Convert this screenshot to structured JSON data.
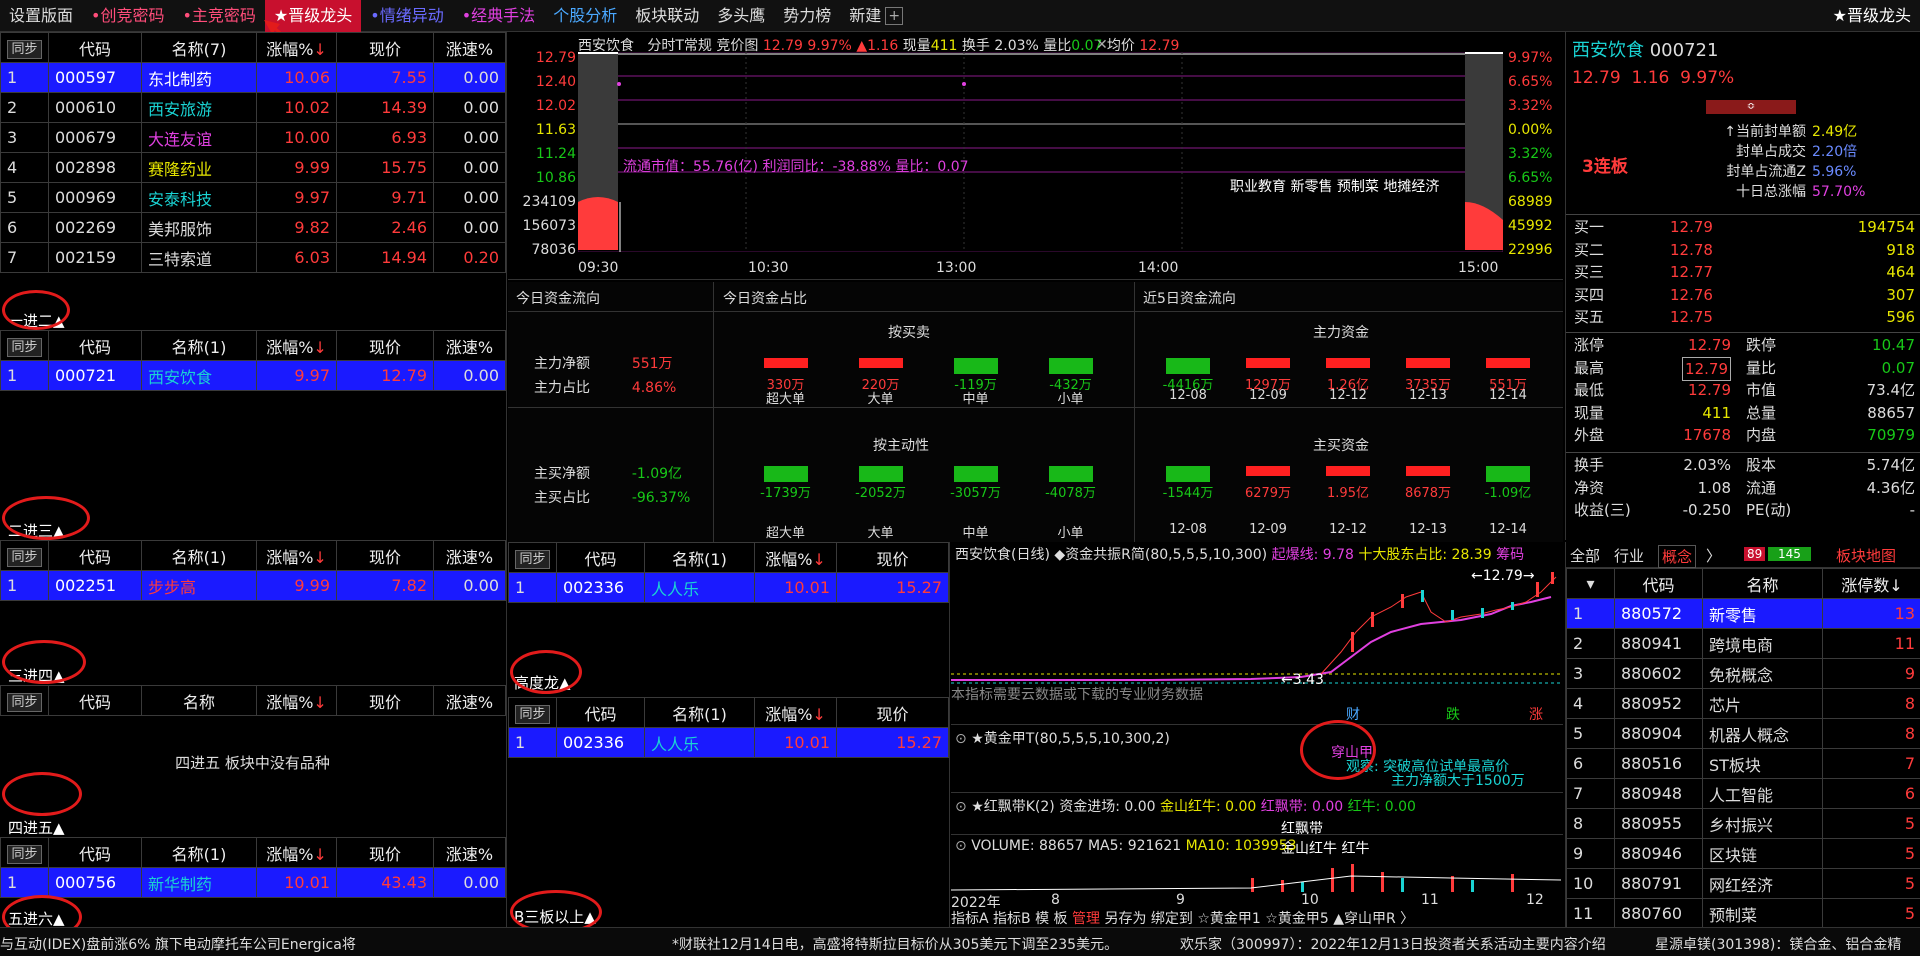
{
  "menu": {
    "items": [
      "设置版面",
      "•创竞密码",
      "•主竞密码",
      "★晋级龙头",
      "•情绪异动",
      "•经典手法",
      "个股分析",
      "板块联动",
      "多头鹰",
      "势力榜",
      "新建"
    ],
    "right": "★晋级龙头"
  },
  "left_tables": {
    "header": {
      "sync": "同步",
      "code": "代码",
      "change": "涨幅%",
      "price": "现价",
      "speed": "涨速%"
    },
    "t1": {
      "name_h": "名称(7)",
      "rows": [
        {
          "i": "1",
          "code": "000597",
          "name": "东北制药",
          "chg": "10.06",
          "price": "7.55",
          "spd": "0.00"
        },
        {
          "i": "2",
          "code": "000610",
          "name": "西安旅游",
          "chg": "10.02",
          "price": "14.39",
          "spd": "0.00"
        },
        {
          "i": "3",
          "code": "000679",
          "name": "大连友谊",
          "chg": "10.00",
          "price": "6.93",
          "spd": "0.00"
        },
        {
          "i": "4",
          "code": "002898",
          "name": "赛隆药业",
          "chg": "9.99",
          "price": "15.75",
          "spd": "0.00"
        },
        {
          "i": "5",
          "code": "000969",
          "name": "安泰科技",
          "chg": "9.97",
          "price": "9.71",
          "spd": "0.00"
        },
        {
          "i": "6",
          "code": "002269",
          "name": "美邦服饰",
          "chg": "9.82",
          "price": "2.46",
          "spd": "0.00"
        },
        {
          "i": "7",
          "code": "002159",
          "name": "三特索道",
          "chg": "6.03",
          "price": "14.94",
          "spd": "0.20"
        }
      ]
    },
    "l2": "一进二▲",
    "t2": {
      "name_h": "名称(1)",
      "rows": [
        {
          "i": "1",
          "code": "000721",
          "name": "西安饮食",
          "chg": "9.97",
          "price": "12.79",
          "spd": "0.00"
        }
      ]
    },
    "l3": "二进三▲",
    "t3": {
      "name_h": "名称(1)",
      "rows": [
        {
          "i": "1",
          "code": "002251",
          "name": "步步高",
          "chg": "9.99",
          "price": "7.82",
          "spd": "0.00"
        }
      ]
    },
    "l4": "三进四▲",
    "t4": {
      "name_h": "名称",
      "empty": "四进五 板块中没有品种"
    },
    "l5": "四进五▲",
    "t5": {
      "name_h": "名称(1)",
      "rows": [
        {
          "i": "1",
          "code": "000756",
          "name": "新华制药",
          "chg": "10.01",
          "price": "43.43",
          "spd": "0.00"
        }
      ]
    },
    "l6": "五进六▲"
  },
  "mid_tables": {
    "t1": {
      "name_h": "名称(1)",
      "rows": [
        {
          "i": "1",
          "code": "002336",
          "name": "人人乐",
          "chg": "10.01",
          "price": "15.27"
        }
      ]
    },
    "l_high": "高度龙▲",
    "t2": {
      "name_h": "名称(1)",
      "rows": [
        {
          "i": "1",
          "code": "002336",
          "name": "人人乐",
          "chg": "10.01",
          "price": "15.27"
        }
      ]
    },
    "l_b3": "B三板以上▲"
  },
  "intraday": {
    "title": "西安饮食",
    "mode": "分时T常规",
    "bid": "竞价图",
    "price": "12.79",
    "pct": "9.97%",
    "chg": "▲1.16",
    "vol_l": "现量",
    "vol": "411",
    "turn_l": "换手",
    "turn": "2.03%",
    "qr_l": "量比",
    "qr": "0.07",
    "avg_l": "均价",
    "avg": "12.79",
    "yl": [
      "12.79",
      "12.40",
      "12.02",
      "11.63",
      "11.24",
      "10.86",
      "234109",
      "156073",
      "78036"
    ],
    "yr": [
      "9.97%",
      "6.65%",
      "3.32%",
      "0.00%",
      "3.32%",
      "6.65%",
      "68989",
      "45992",
      "22996"
    ],
    "info": "流通市值：55.76(亿)   利润同比：-38.88%   量比：0.07",
    "tags": "职业教育 新零售 预制菜 地摊经济",
    "times": [
      "09:30",
      "10:30",
      "13:00",
      "14:00",
      "15:00"
    ]
  },
  "flow": {
    "h1": "今日资金流向",
    "h2": "今日资金占比",
    "h3": "近5日资金流向",
    "main_net_l": "主力净额",
    "main_net": "551万",
    "main_pct_l": "主力占比",
    "main_pct": "4.86%",
    "buy_net_l": "主买净额",
    "buy_net": "-1.09亿",
    "buy_pct_l": "主买占比",
    "buy_pct": "-96.37%",
    "c1_title": "按买卖",
    "c1": [
      {
        "v": "330万",
        "l": "超大单",
        "s": 1
      },
      {
        "v": "220万",
        "l": "大单",
        "s": 1
      },
      {
        "v": "-119万",
        "l": "中单",
        "s": -1
      },
      {
        "v": "-432万",
        "l": "小单",
        "s": -1
      }
    ],
    "c2_title": "按主动性",
    "c2": [
      {
        "v": "-1739万",
        "l": "超大单",
        "s": -1
      },
      {
        "v": "-2052万",
        "l": "大单",
        "s": -1
      },
      {
        "v": "-3057万",
        "l": "中单",
        "s": -1
      },
      {
        "v": "-4078万",
        "l": "小单",
        "s": -1
      }
    ],
    "c3_title": "主力资金",
    "c3": [
      {
        "v": "-4416万",
        "l": "12-08",
        "s": -1
      },
      {
        "v": "1297万",
        "l": "12-09",
        "s": 1
      },
      {
        "v": "1.26亿",
        "l": "12-12",
        "s": 1
      },
      {
        "v": "3735万",
        "l": "12-13",
        "s": 1
      },
      {
        "v": "551万",
        "l": "12-14",
        "s": 1
      }
    ],
    "c4_title": "主买资金",
    "c4": [
      {
        "v": "-1544万",
        "l": "12-08",
        "s": -1
      },
      {
        "v": "6279万",
        "l": "12-09",
        "s": 1
      },
      {
        "v": "1.95亿",
        "l": "12-12",
        "s": 1
      },
      {
        "v": "8678万",
        "l": "12-13",
        "s": 1
      },
      {
        "v": "-1.09亿",
        "l": "12-14",
        "s": -1
      }
    ]
  },
  "kline": {
    "head": "西安饮食(日线) ◆资金共振R简(80,5,5,5,10,300)",
    "head2": "起爆线: 9.78",
    "head3": "十大股东占比: 28.39",
    "head4": "筹码",
    "high": "12.79",
    "low": "3.43",
    "note": "本指标需要云数据或下载的专业财务数据",
    "marks": [
      "财",
      "跌",
      "涨"
    ],
    "ind1": "★黄金甲T(80,5,5,5,10,300,2)",
    "ind1a": "穿山甲",
    "ind1b": "观察: 突破高位试单最高价",
    "ind1c": "主力净额大于1500万",
    "ind2": "★红飘带K(2)  资金进场: 0.00",
    "ind2a": "金山红牛: 0.00",
    "ind2b": "红飘带: 0.00",
    "ind2c": "红牛: 0.00",
    "ind2d": "红飘带",
    "ind2e": "金山红牛",
    "ind2f": "红牛",
    "ind3": "VOLUME: 88657  MA5: 921621",
    "ind3a": "MA10: 1039953",
    "xl": [
      "2022年",
      "8",
      "9",
      "10",
      "11",
      "12"
    ],
    "tabs": [
      "指标A",
      "指标B",
      "模",
      "板",
      "管理",
      "另存为",
      "绑定到",
      "☆黄金甲1",
      "☆黄金甲5",
      "▲穿山甲R",
      "〉"
    ]
  },
  "quote": {
    "name": "西安饮食",
    "code": "000721",
    "price": "12.79",
    "chg": "1.16",
    "pct": "9.97%",
    "boards": "3连板",
    "seal": [
      {
        "l": "↑当前封单额",
        "v": "2.49亿"
      },
      {
        "l": "封单占成交",
        "v": "2.20倍"
      },
      {
        "l": "封单占流通Z",
        "v": "5.96%"
      },
      {
        "l": "十日总涨幅",
        "v": "57.70%"
      }
    ],
    "book": [
      {
        "l": "买一",
        "p": "12.79",
        "v": "194754"
      },
      {
        "l": "买二",
        "p": "12.78",
        "v": "918"
      },
      {
        "l": "买三",
        "p": "12.77",
        "v": "464"
      },
      {
        "l": "买四",
        "p": "12.76",
        "v": "307"
      },
      {
        "l": "买五",
        "p": "12.75",
        "v": "596"
      }
    ],
    "stats1": [
      [
        "涨停",
        "12.79",
        "跌停",
        "10.47"
      ],
      [
        "最高",
        "12.79",
        "量比",
        "0.07"
      ],
      [
        "最低",
        "12.79",
        "市值",
        "73.4亿"
      ],
      [
        "现量",
        "411",
        "总量",
        "88657"
      ],
      [
        "外盘",
        "17678",
        "内盘",
        "70979"
      ]
    ],
    "stats2": [
      [
        "换手",
        "2.03%",
        "股本",
        "5.74亿"
      ],
      [
        "净资",
        "1.08",
        "流通",
        "4.36亿"
      ],
      [
        "收益(三)",
        "-0.250",
        "PE(动)",
        "-"
      ]
    ]
  },
  "sectors": {
    "tabs": [
      "全部",
      "行业",
      "概念",
      "〉"
    ],
    "up": "89",
    "down": "145",
    "map": "板块地图",
    "h": {
      "code": "代码",
      "name": "名称",
      "cnt": "涨停数↓"
    },
    "rows": [
      {
        "i": "1",
        "code": "880572",
        "name": "新零售",
        "n": "13"
      },
      {
        "i": "2",
        "code": "880941",
        "name": "跨境电商",
        "n": "11"
      },
      {
        "i": "3",
        "code": "880602",
        "name": "免税概念",
        "n": "9"
      },
      {
        "i": "4",
        "code": "880952",
        "name": "芯片",
        "n": "8"
      },
      {
        "i": "5",
        "code": "880904",
        "name": "机器人概念",
        "n": "8"
      },
      {
        "i": "6",
        "code": "880516",
        "name": "ST板块",
        "n": "7"
      },
      {
        "i": "7",
        "code": "880948",
        "name": "人工智能",
        "n": "6"
      },
      {
        "i": "8",
        "code": "880955",
        "name": "乡村振兴",
        "n": "5"
      },
      {
        "i": "9",
        "code": "880946",
        "name": "区块链",
        "n": "5"
      },
      {
        "i": "10",
        "code": "880791",
        "name": "网红经济",
        "n": "5"
      },
      {
        "i": "11",
        "code": "880760",
        "name": "预制菜",
        "n": "5"
      }
    ]
  },
  "ticker": [
    "与互动(IDEX)盘前涨6% 旗下电动摩托车公司Energica将",
    "*财联社12月14日电，高盛将特斯拉目标价从305美元下调至235美元。",
    "欢乐家（300997）：2022年12月13日投资者关系活动主要内容介绍",
    "星源卓镁(301398)：镁合金、铝合金精"
  ]
}
